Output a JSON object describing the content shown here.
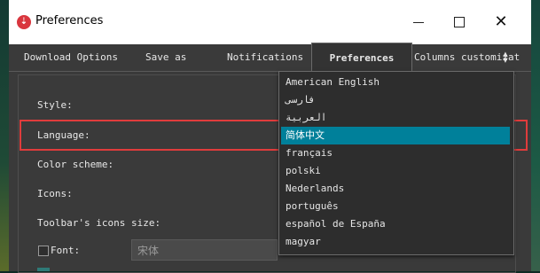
{
  "window": {
    "title": "Preferences"
  },
  "tabs": [
    {
      "label": "Download Options"
    },
    {
      "label": "Save as"
    },
    {
      "label": "Notifications"
    },
    {
      "label": "Preferences",
      "active": true
    },
    {
      "label": "Columns customizat"
    }
  ],
  "form": {
    "style_label": "Style:",
    "language_label": "Language:",
    "color_scheme_label": "Color scheme:",
    "icons_label": "Icons:",
    "toolbar_icons_size_label": "Toolbar's icons size:",
    "font_label": "Font:",
    "font_value": "宋体"
  },
  "language_dropdown": {
    "selected": "简体中文",
    "options": [
      "American English",
      "فارسی",
      "العربية",
      "简体中文",
      "français",
      "polski",
      "Nederlands",
      "português",
      "español de España",
      "magyar"
    ]
  },
  "colors": {
    "selection": "#00809a",
    "annotation": "#e03c3c",
    "window_bg": "#3a3a3a"
  }
}
